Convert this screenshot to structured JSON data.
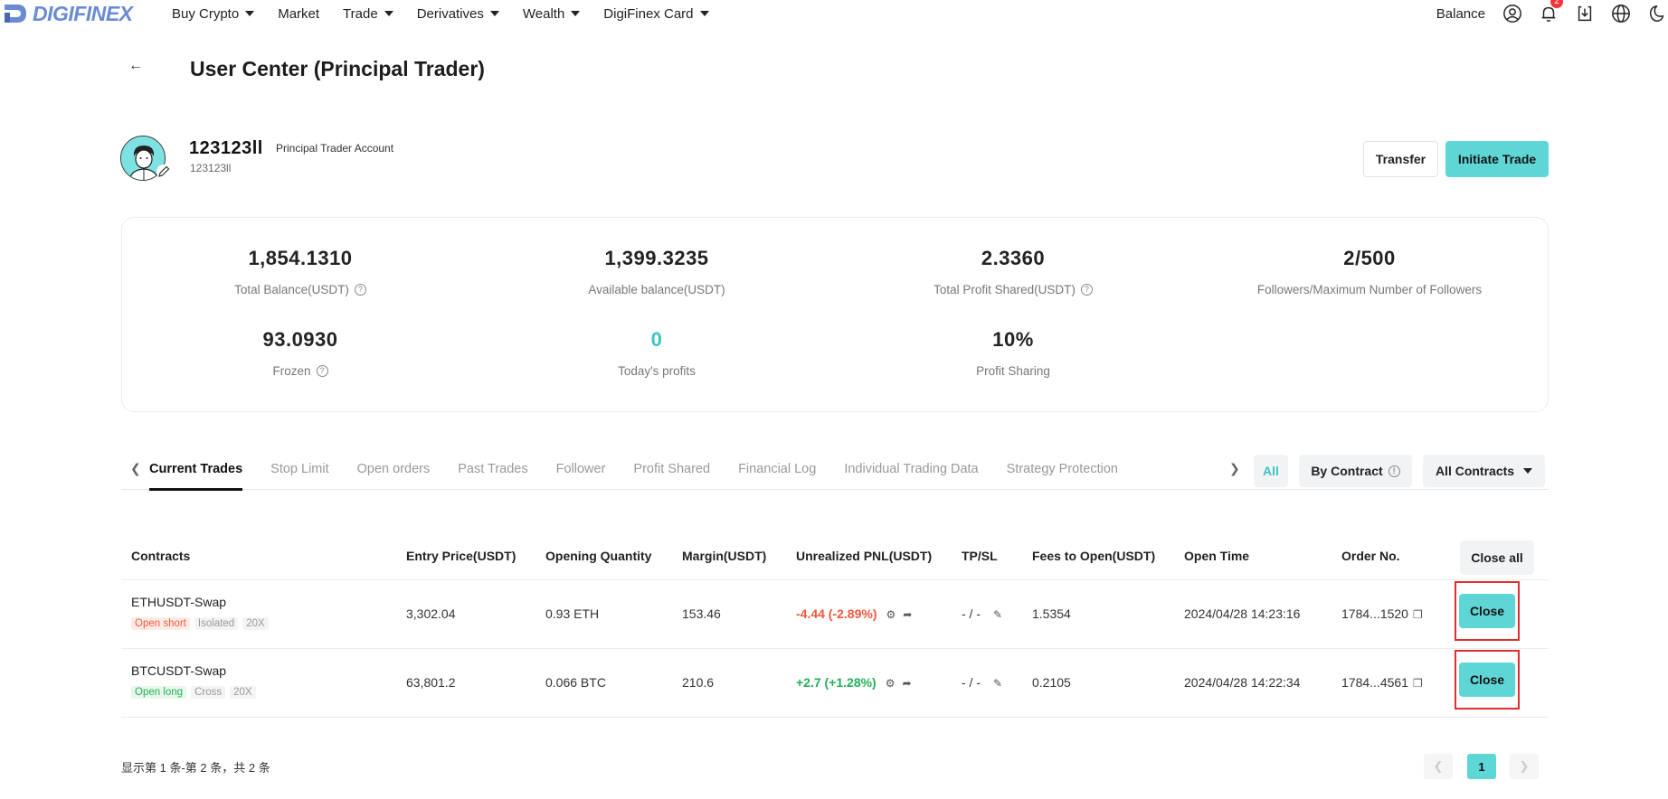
{
  "nav": {
    "logo_text": "DIGIFINEX",
    "items": [
      {
        "label": "Buy Crypto",
        "has_caret": true
      },
      {
        "label": "Market",
        "has_caret": false
      },
      {
        "label": "Trade",
        "has_caret": true
      },
      {
        "label": "Derivatives",
        "has_caret": true
      },
      {
        "label": "Wealth",
        "has_caret": true
      },
      {
        "label": "DigiFinex Card",
        "has_caret": true
      }
    ],
    "balance_label": "Balance",
    "notification_count": "2",
    "icons": [
      "user-icon",
      "bell-icon",
      "download-icon",
      "globe-icon",
      "moon-icon"
    ]
  },
  "header": {
    "back_label": "←",
    "title": "User Center (Principal Trader)"
  },
  "profile": {
    "username": "123123ll",
    "account_type": "Principal Trader Account",
    "user_id": "123123ll",
    "transfer_label": "Transfer",
    "initiate_label": "Initiate Trade"
  },
  "stats": {
    "total_balance": {
      "value": "1,854.1310",
      "label": "Total Balance(USDT)"
    },
    "available_balance": {
      "value": "1,399.3235",
      "label": "Available balance(USDT)"
    },
    "total_profit_shared": {
      "value": "2.3360",
      "label": "Total Profit Shared(USDT)"
    },
    "followers": {
      "value": "2/500",
      "label": "Followers/Maximum Number of Followers"
    },
    "frozen": {
      "value": "93.0930",
      "label": "Frozen"
    },
    "todays_profits": {
      "value": "0",
      "label": "Today's profits"
    },
    "profit_sharing": {
      "value": "10%",
      "label": "Profit Sharing"
    }
  },
  "tabs": {
    "items": [
      "Current Trades",
      "Stop Limit",
      "Open orders",
      "Past Trades",
      "Follower",
      "Profit Shared",
      "Financial Log",
      "Individual Trading Data",
      "Strategy Protection"
    ],
    "active": "Current Trades",
    "filter_all": "All",
    "filter_by_contract": "By Contract",
    "filter_all_contracts": "All Contracts"
  },
  "table": {
    "headers": {
      "contracts": "Contracts",
      "entry_price": "Entry Price(USDT)",
      "opening_quantity": "Opening Quantity",
      "margin": "Margin(USDT)",
      "unrealized_pnl": "Unrealized PNL(USDT)",
      "tpsl": "TP/SL",
      "fees": "Fees to Open(USDT)",
      "open_time": "Open Time",
      "order_no": "Order No.",
      "close_all": "Close all"
    },
    "rows": [
      {
        "pair": "ETHUSDT-Swap",
        "side": "Open short",
        "margin_mode": "Isolated",
        "leverage": "20X",
        "entry_price": "3,302.04",
        "quantity": "0.93 ETH",
        "margin": "153.46",
        "pnl": "-4.44 (-2.89%)",
        "tpsl": "- / -",
        "fees": "1.5354",
        "open_time": "2024/04/28 14:23:16",
        "order_no": "1784...1520",
        "close_label": "Close"
      },
      {
        "pair": "BTCUSDT-Swap",
        "side": "Open long",
        "margin_mode": "Cross",
        "leverage": "20X",
        "entry_price": "63,801.2",
        "quantity": "0.066 BTC",
        "margin": "210.6",
        "pnl": "+2.7 (+1.28%)",
        "tpsl": "- / -",
        "fees": "0.2105",
        "open_time": "2024/04/28 14:22:34",
        "order_no": "1784...4561",
        "close_label": "Close"
      }
    ]
  },
  "footer": {
    "summary": "显示第 1 条-第 2 条，共 2 条",
    "current_page": "1"
  },
  "colors": {
    "accent": "#5ed6d6",
    "negative": "#f5573a",
    "positive": "#22b157",
    "highlight_border": "#e02d2d"
  }
}
